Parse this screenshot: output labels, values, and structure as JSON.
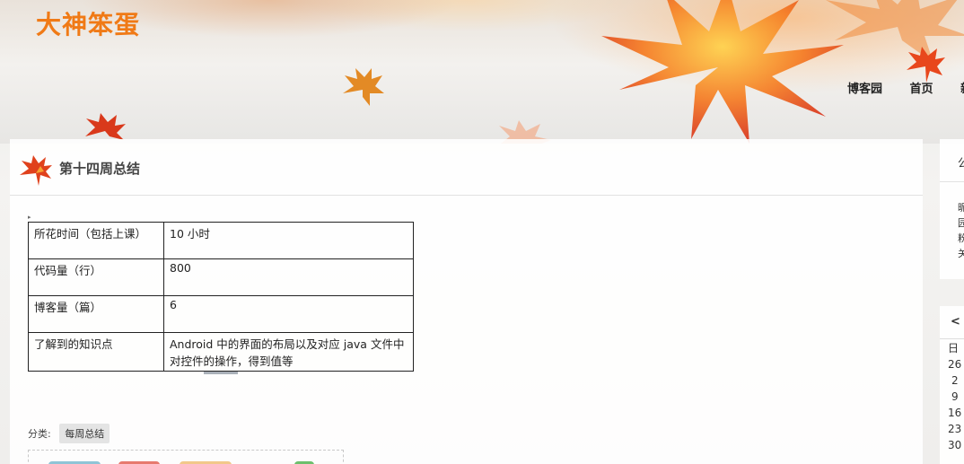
{
  "site": {
    "title": "大神笨蛋"
  },
  "nav": {
    "items": [
      "博客园",
      "首页",
      "新"
    ]
  },
  "post": {
    "title": "第十四周总结",
    "table": [
      {
        "k": "所花时间（包括上课）",
        "v": "10 小时"
      },
      {
        "k": "代码量（行）",
        "v": "800"
      },
      {
        "k": "博客量（篇）",
        "v": "6"
      },
      {
        "k": "了解到的知识点",
        "v": "Android  中的界面的布局以及对应 java 文件中对控件的操作，得到值等"
      }
    ],
    "category_label": "分类:",
    "category_tag": "每周总结"
  },
  "sidebar": {
    "notice_head": "公",
    "notice_lines": [
      "昵",
      "园",
      "粉",
      "关"
    ],
    "calendar": {
      "prev": "<",
      "weekday_head": "日",
      "days": [
        "26",
        "2",
        "9",
        "16",
        "23",
        "30"
      ]
    }
  },
  "colors": {
    "title_orange": "#f07a16",
    "leaf_red": "#e8471c",
    "leaf_orange": "#f59a2a"
  }
}
